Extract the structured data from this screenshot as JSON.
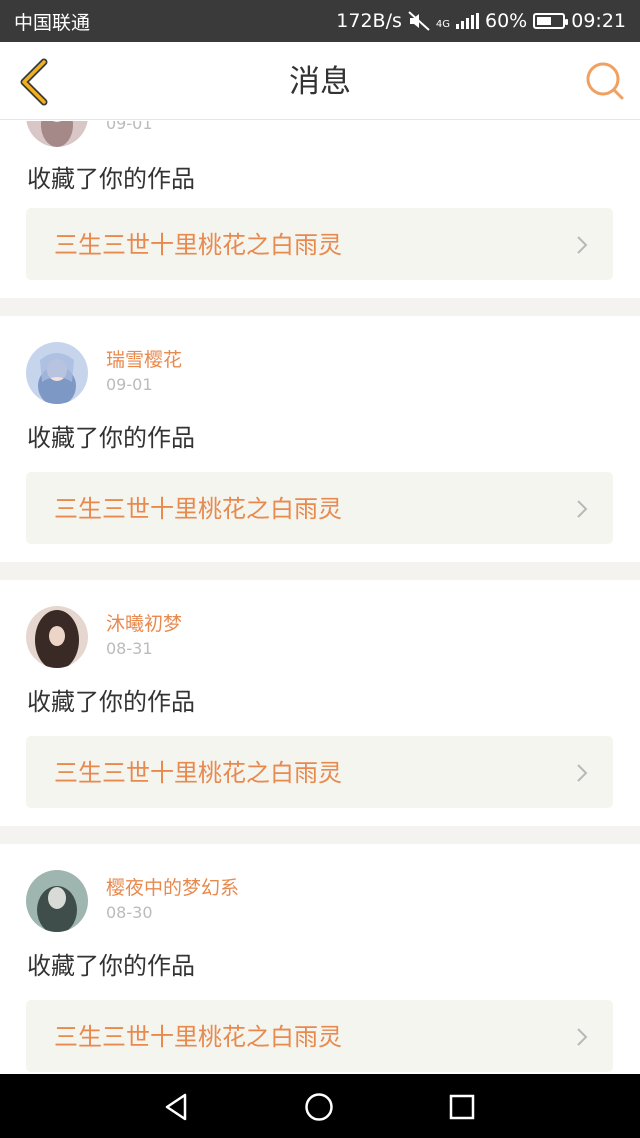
{
  "status_bar": {
    "carrier": "中国联通",
    "speed": "172B/s",
    "network": "4G",
    "battery": "60%",
    "battery_level": 0.6,
    "time": "09:21"
  },
  "header": {
    "title": "消息",
    "back_icon": "chevron-left-icon",
    "search_icon": "search-icon"
  },
  "messages": [
    {
      "user": "",
      "date": "09-01",
      "action": "收藏了你的作品",
      "work": "三生三世十里桃花之白雨灵"
    },
    {
      "user": "瑞雪樱花",
      "date": "09-01",
      "action": "收藏了你的作品",
      "work": "三生三世十里桃花之白雨灵"
    },
    {
      "user": "沐曦初梦",
      "date": "08-31",
      "action": "收藏了你的作品",
      "work": "三生三世十里桃花之白雨灵"
    },
    {
      "user": "樱夜中的梦幻系",
      "date": "08-30",
      "action": "收藏了你的作品",
      "work": "三生三世十里桃花之白雨灵"
    }
  ],
  "colors": {
    "accent": "#e8894e",
    "back_icon": "#e0a020",
    "status_bar_bg": "#3a3a3a",
    "separator": "#f5f3f0"
  },
  "system_nav": {
    "back": "triangle-back-icon",
    "home": "circle-home-icon",
    "recents": "square-recents-icon"
  }
}
